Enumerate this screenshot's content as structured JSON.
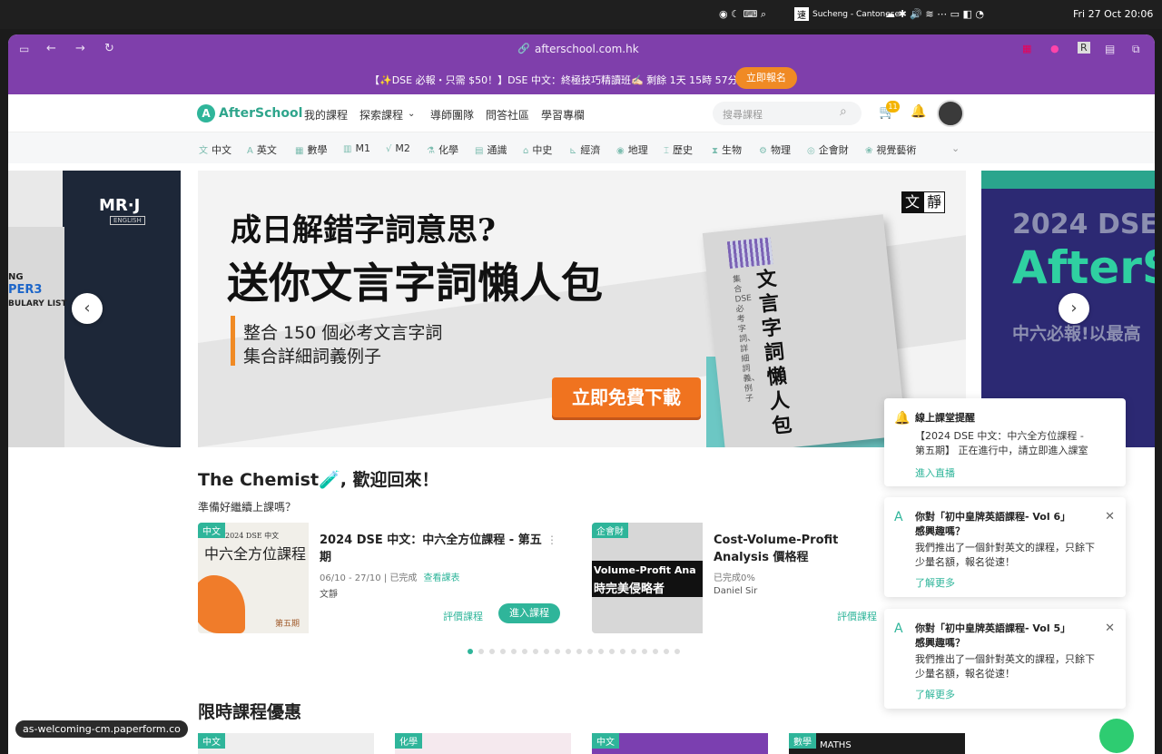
{
  "menubar": {
    "input_method": "Sucheng - Cantonese",
    "datetime": "Fri 27 Oct  20:06",
    "ime_char": "速"
  },
  "browser": {
    "url": "afterschool.com.hk"
  },
  "promo": {
    "text": "【✨DSE 必報・只需 $50！】DSE 中文：終極技巧精讀班✍🏻 剩餘 1天 15時 57分 10秒",
    "button": "立即報名"
  },
  "nav": {
    "logo": "AfterSchool",
    "links": [
      "我的課程",
      "探索課程",
      "導師團隊",
      "問答社區",
      "學習專欄"
    ],
    "search_placeholder": "搜尋課程",
    "cart_count": "11"
  },
  "subjects": [
    "中文",
    "英文",
    "數學",
    "M1",
    "M2",
    "化學",
    "通識",
    "中史",
    "經濟",
    "地理",
    "歷史",
    "生物",
    "物理",
    "企會財",
    "視覺藝術"
  ],
  "banner_left": {
    "brand": "MR·J",
    "sub": "ENGLISH",
    "lines": [
      "NG",
      "PER3",
      "BULARY LIST"
    ]
  },
  "banner": {
    "headline1": "成日解錯字詞意思?",
    "headline2": "送你文言字詞懶人包",
    "sub1": "整合 150 個必考文言字詞",
    "sub2": "集合詳細詞義例子",
    "cta": "立即免費下載",
    "book_title": "文言字詞懶人包",
    "book_sub": "集合DSE必考字詞、詳細詞義、例子",
    "brand1": "文",
    "brand2": "靜"
  },
  "banner_right": {
    "line1": "2024 DSE",
    "line2": "AfterS",
    "line3": "中六必報!以最高"
  },
  "welcome": {
    "title": "The Chemist🧪, 歡迎回來！",
    "subtitle": "準備好繼續上課嗎？"
  },
  "courses": [
    {
      "tag": "中文",
      "title": "2024 DSE 中文：中六全方位課程 - 第五期",
      "dates": "06/10 - 27/10",
      "status": "已完成",
      "link": "查看課表",
      "teacher": "文靜",
      "rate": "評價課程",
      "enter": "進入課程",
      "thumb_title": "中六全方位課程",
      "thumb_sub": "2024 DSE 中文",
      "thumb_phase": "第五期"
    },
    {
      "tag": "企會財",
      "title": "Cost-Volume-Profit Analysis 價格程",
      "progress": "已完成0%",
      "teacher": "Daniel Sir",
      "rate": "評價課程",
      "thumb_line1": "Volume-Profit Ana",
      "thumb_line2": "時完美侵略者"
    }
  ],
  "limited": {
    "title": "限時課程優惠",
    "tags": [
      "中文",
      "化學",
      "中文",
      "數學"
    ],
    "card4_text": "MATHS"
  },
  "notifications": [
    {
      "title": "線上課堂提醒",
      "body": "【2024 DSE 中文：中六全方位課程 - 第五期】 正在進行中，請立即進入課室",
      "link": "進入直播"
    },
    {
      "title": "你對「初中皇牌英語課程- Vol 6」感興趣嗎？",
      "body": "我們推出了一個針對英文的課程，只餘下少量名額，報名從速！",
      "link": "了解更多"
    },
    {
      "title": "你對「初中皇牌英語課程- Vol 5」感興趣嗎？",
      "body": "我們推出了一個針對英文的課程，只餘下少量名額，報名從速！",
      "link": "了解更多"
    }
  ],
  "status_link": "as-welcoming-cm.paperform.co",
  "colors": {
    "brand": "#2fb59a",
    "promo_bg": "#7f3fab",
    "cta": "#f08a24"
  }
}
